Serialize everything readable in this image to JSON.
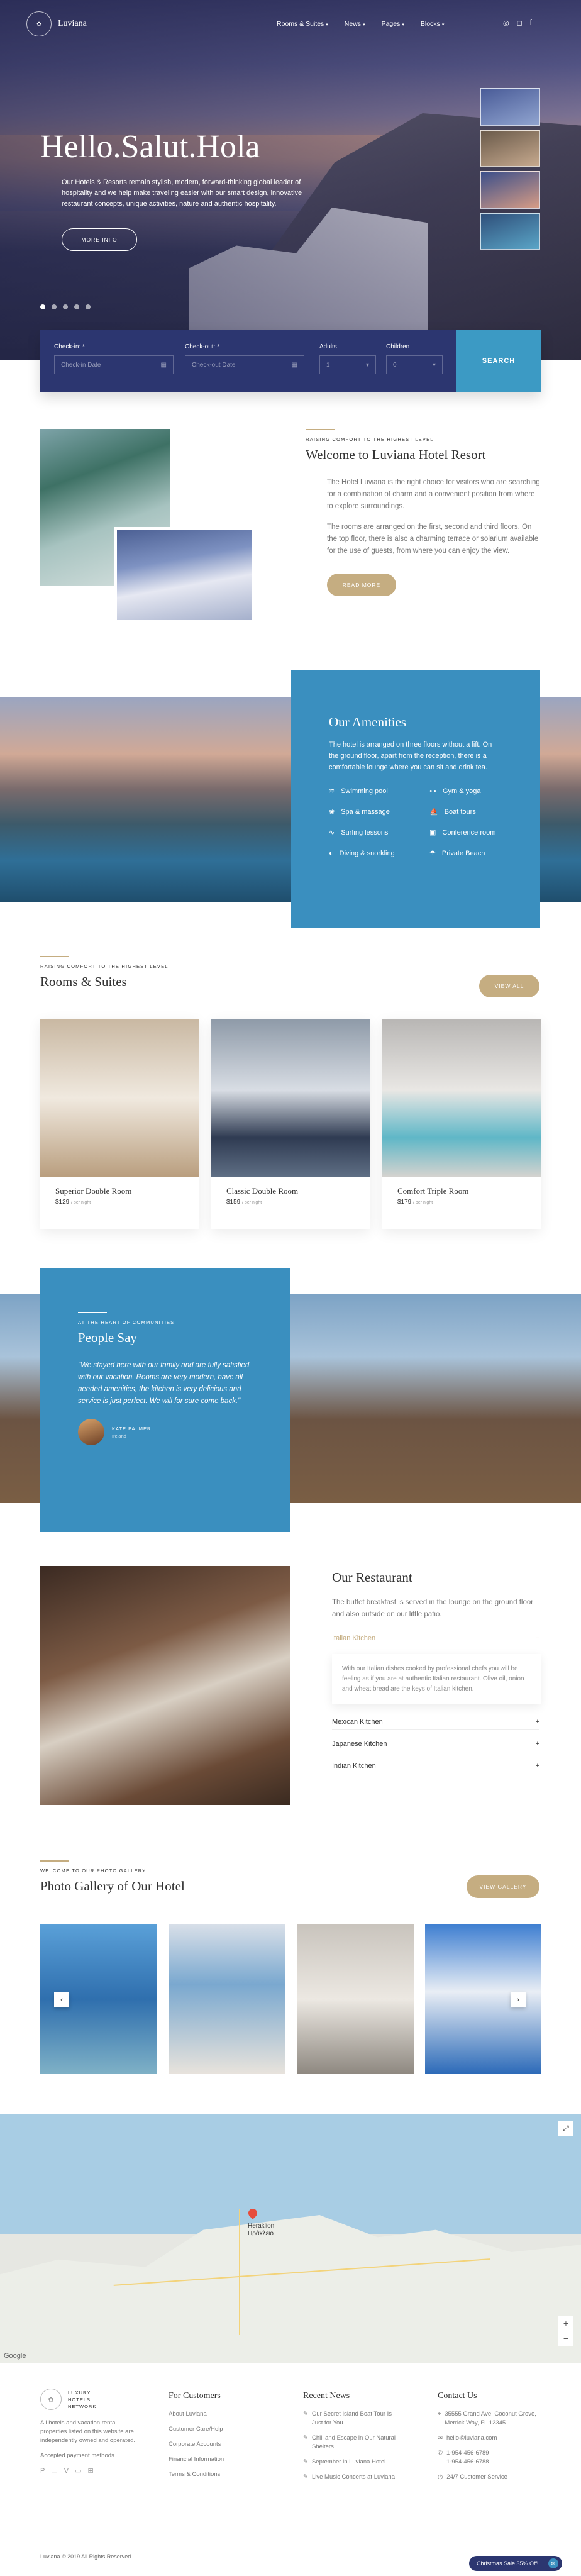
{
  "brand": {
    "name": "Luviana",
    "logo_mark": "✿"
  },
  "nav": {
    "items": [
      {
        "label": "Rooms & Suites"
      },
      {
        "label": "News"
      },
      {
        "label": "Pages"
      },
      {
        "label": "Blocks"
      }
    ],
    "social_icons": [
      "tripadvisor-icon",
      "instagram-icon",
      "facebook-icon"
    ]
  },
  "hero": {
    "title": "Hello.Salut.Hola",
    "text": "Our Hotels & Resorts remain stylish, modern, forward-thinking global leader of hospitality and we help make traveling easier with our smart design, innovative restaurant concepts, unique activities, nature and authentic hospitality.",
    "button": "MORE INFO",
    "slide_count": 5,
    "active_slide": 1
  },
  "booking": {
    "checkin_label": "Check-in: *",
    "checkin_placeholder": "Check-in Date",
    "checkout_label": "Check-out: *",
    "checkout_placeholder": "Check-out Date",
    "adults_label": "Adults",
    "adults_value": "1",
    "children_label": "Children",
    "children_value": "0",
    "search_label": "SEARCH"
  },
  "welcome": {
    "eyebrow": "RAISING COMFORT TO THE HIGHEST LEVEL",
    "title": "Welcome to Luviana Hotel Resort",
    "p1": "The Hotel Luviana is the right choice for visitors who are searching for a combination of charm and a convenient position from where to explore surroundings.",
    "p2": "The rooms are arranged on the first, second and third floors. On the top floor, there is also a charming terrace or solarium available for the use of guests, from where you can enjoy the view.",
    "button": "READ MORE"
  },
  "amenities": {
    "title": "Our Amenities",
    "text": "The hotel is arranged on three floors without a lift. On the ground floor, apart from the reception, there is a comfortable lounge where you can sit and drink tea.",
    "items": [
      {
        "label": "Swimming pool",
        "icon": "pool-icon"
      },
      {
        "label": "Gym & yoga",
        "icon": "dumbbell-icon"
      },
      {
        "label": "Spa & massage",
        "icon": "spa-icon"
      },
      {
        "label": "Boat tours",
        "icon": "boat-icon"
      },
      {
        "label": "Surfing lessons",
        "icon": "surf-icon"
      },
      {
        "label": "Conference room",
        "icon": "conference-icon"
      },
      {
        "label": "Diving & snorkling",
        "icon": "diving-icon"
      },
      {
        "label": "Private Beach",
        "icon": "beach-icon"
      }
    ]
  },
  "rooms": {
    "eyebrow": "RAISING COMFORT TO THE HIGHEST LEVEL",
    "title": "Rooms & Suites",
    "button": "VIEW ALL",
    "items": [
      {
        "name": "Superior Double Room",
        "price": "$129",
        "unit": "/ per night"
      },
      {
        "name": "Classic Double Room",
        "price": "$159",
        "unit": "/ per night"
      },
      {
        "name": "Comfort Triple Room",
        "price": "$179",
        "unit": "/ per night"
      }
    ]
  },
  "testimonial": {
    "eyebrow": "AT THE HEART OF COMMUNITIES",
    "title": "People Say",
    "quote": "\"We stayed here with our family and are fully satisfied with our vacation. Rooms are very modern, have all needed amenities, the kitchen is very delicious and service is just perfect. We will for sure come back.\"",
    "author": "KATE PALMER",
    "role": "Ireland"
  },
  "restaurant": {
    "title": "Our Restaurant",
    "text": "The buffet breakfast is served in the lounge on the ground floor and also outside on our little patio.",
    "open_item": "Italian Kitchen",
    "open_text": "With our Italian dishes cooked by professional chefs you will be feeling as if you are at authentic Italian restaurant. Olive oil, onion and wheat bread are the keys of Italian kitchen.",
    "items": [
      "Mexican Kitchen",
      "Japanese Kitchen",
      "Indian Kitchen"
    ]
  },
  "gallery": {
    "eyebrow": "WELCOME TO OUR PHOTO GALLERY",
    "title": "Photo Gallery of Our Hotel",
    "button": "VIEW GALLERY"
  },
  "map": {
    "city": "Heraklion",
    "city_greek": "Ηράκλειο",
    "credit": "Google"
  },
  "footer": {
    "network": [
      "LUXURY",
      "HOTELS",
      "NETWORK"
    ],
    "about": "All hotels and vacation rental properties listed on this website are independently owned and operated.",
    "payment": "Accepted payment methods",
    "customers_title": "For Customers",
    "customers": [
      "About Luviana",
      "Customer Care/Help",
      "Corporate Accounts",
      "Financial Information",
      "Terms & Conditions"
    ],
    "news_title": "Recent News",
    "news": [
      "Our Secret Island Boat Tour Is Just for You",
      "Chill and Escape in Our Natural Shelters",
      "September in Luviana Hotel",
      "Live Music Concerts at Luviana"
    ],
    "contact_title": "Contact Us",
    "contact": [
      "35555 Grand Ave. Coconut Grove, Merrick Way, FL 12345",
      "hello@luviana.com",
      "1-954-456-6789",
      "1-954-456-6788",
      "24/7 Customer Service"
    ],
    "copyright": "Luviana © 2019 All Rights Reserved",
    "badge": "Christmas Sale 35% Off!"
  },
  "colors": {
    "navy": "#2c3670",
    "blue": "#3a8fbf",
    "gold": "#c5ad81"
  }
}
